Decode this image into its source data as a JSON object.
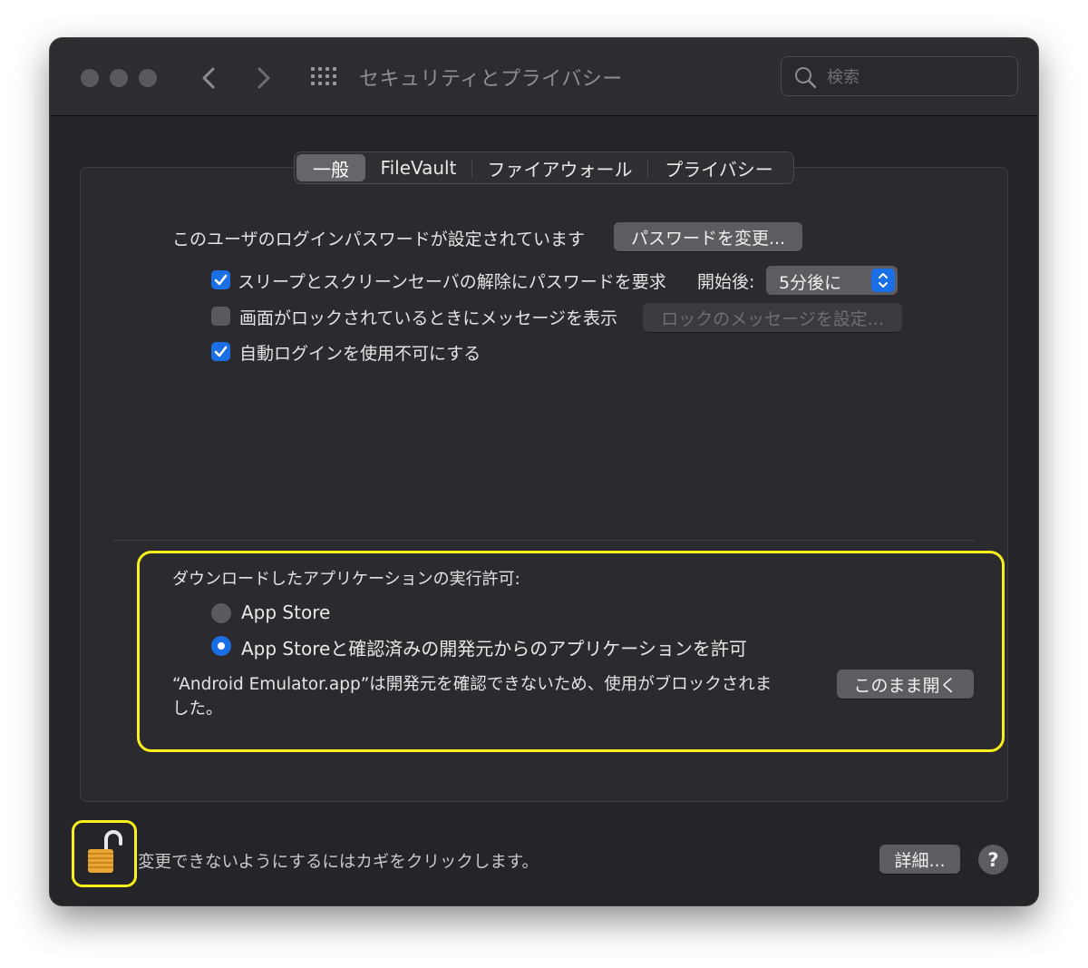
{
  "window": {
    "title": "セキュリティとプライバシー",
    "search_placeholder": "検索"
  },
  "tabs": [
    {
      "label": "一般",
      "active": true
    },
    {
      "label": "FileVault",
      "active": false
    },
    {
      "label": "ファイアウォール",
      "active": false
    },
    {
      "label": "プライバシー",
      "active": false
    }
  ],
  "general": {
    "password_text": "このユーザのログインパスワードが設定されています",
    "change_password_button": "パスワードを変更...",
    "require_password": {
      "label": "スリープとスクリーンセーバの解除にパスワードを要求",
      "checked": true
    },
    "after_label": "開始後:",
    "after_value": "5分後に",
    "show_message": {
      "label": "画面がロックされているときにメッセージを表示",
      "checked": false
    },
    "set_lock_message_button": "ロックのメッセージを設定...",
    "disable_auto_login": {
      "label": "自動ログインを使用不可にする",
      "checked": true
    }
  },
  "downloads": {
    "heading": "ダウンロードしたアプリケーションの実行許可:",
    "options": [
      {
        "label": "App Store",
        "selected": false
      },
      {
        "label": "App Storeと確認済みの開発元からのアプリケーションを許可",
        "selected": true
      }
    ],
    "blocked_line1": "“Android Emulator.app”は開発元を確認できないため、使用がブロックされま",
    "blocked_line2": "した。",
    "open_anyway_button": "このまま開く"
  },
  "footer": {
    "lock_text": "変更できないようにするにはカギをクリックします。",
    "advanced_button": "詳細...",
    "help_label": "?"
  },
  "colors": {
    "accent": "#1b6fe6",
    "highlight": "#f7f01c"
  },
  "icons": [
    "back-arrow-icon",
    "forward-arrow-icon",
    "grid-icon",
    "search-icon",
    "checkmark-icon",
    "chevron-updown-icon",
    "lock-open-icon"
  ]
}
